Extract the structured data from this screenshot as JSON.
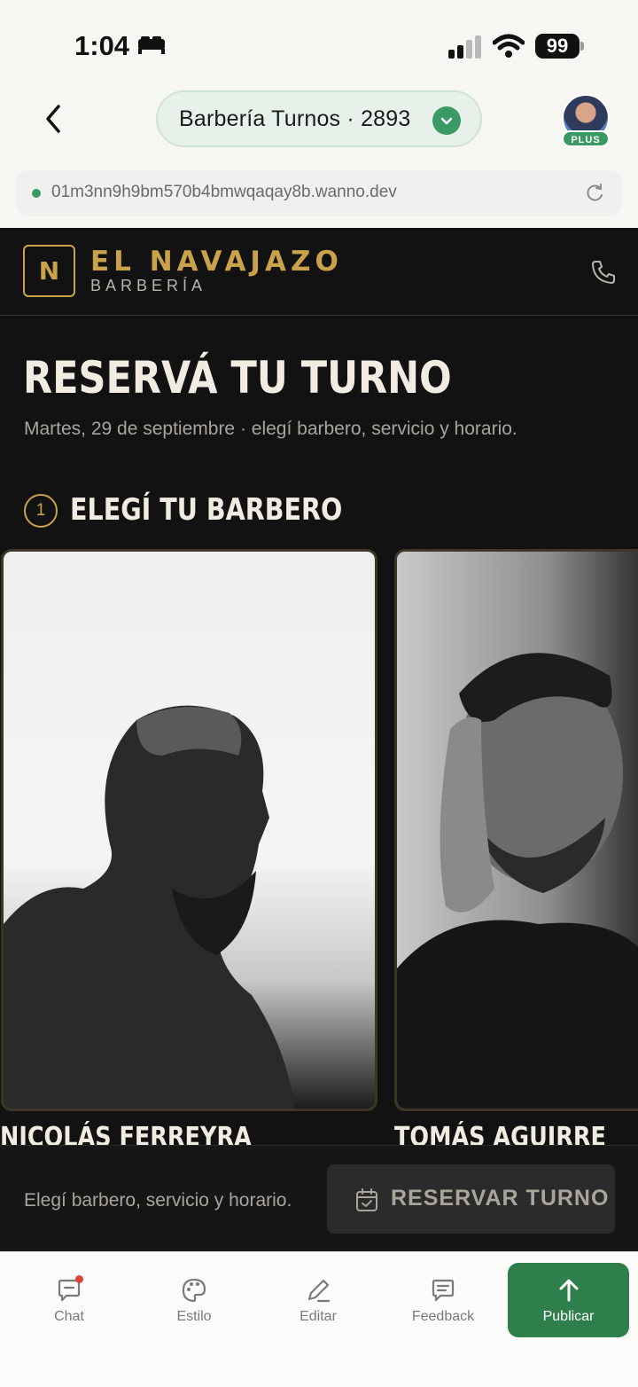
{
  "status_bar": {
    "time": "1:04",
    "battery": "99"
  },
  "nav": {
    "project_title": "Barbería Turnos · 2893",
    "plan_badge": "PLUS"
  },
  "url_bar": {
    "url": "01m3nn9h9bm570b4bmwqaqay8b.wanno.dev"
  },
  "site": {
    "logo_letter": "N",
    "brand_name": "EL NAVAJAZO",
    "brand_sub": "BARBERÍA",
    "hero_title": "RESERVÁ TU TURNO",
    "hero_subtitle": "Martes, 29 de septiembre · elegí barbero, servicio y horario.",
    "step": {
      "number": "1",
      "title": "ELEGÍ TU BARBERO"
    },
    "barbers": [
      {
        "name": "NICOLÁS FERREYRA"
      },
      {
        "name": "TOMÁS AGUIRRE"
      }
    ],
    "footer_hint": "Elegí barbero, servicio y horario.",
    "reserve_button": "RESERVAR TURNO"
  },
  "tabs": [
    {
      "label": "Chat",
      "icon": "chat-icon"
    },
    {
      "label": "Estilo",
      "icon": "palette-icon"
    },
    {
      "label": "Editar",
      "icon": "pencil-icon"
    },
    {
      "label": "Feedback",
      "icon": "feedback-icon"
    },
    {
      "label": "Publicar",
      "icon": "arrow-up-icon"
    }
  ],
  "colors": {
    "accent_gold": "#c9a24a",
    "brand_green": "#3b9a63",
    "page_dark": "#121212"
  }
}
